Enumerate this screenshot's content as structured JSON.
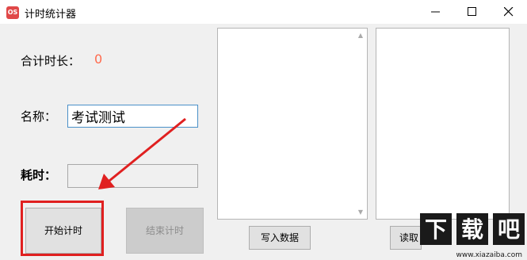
{
  "window": {
    "icon_text": "OS",
    "title": "计时统计器"
  },
  "form": {
    "total_label": "合计时长：",
    "total_value": "0",
    "name_label": "名称：",
    "name_value": "考试测试",
    "elapsed_label": "耗时：",
    "elapsed_value": ""
  },
  "buttons": {
    "start": "开始计时",
    "end": "结束计时",
    "write": "写入数据",
    "read": "读取"
  },
  "watermark": {
    "logo": "下载吧",
    "url": "www.xiazaiba.com"
  },
  "colors": {
    "highlight": "#e02020",
    "total_value": "#ff6a4d"
  }
}
